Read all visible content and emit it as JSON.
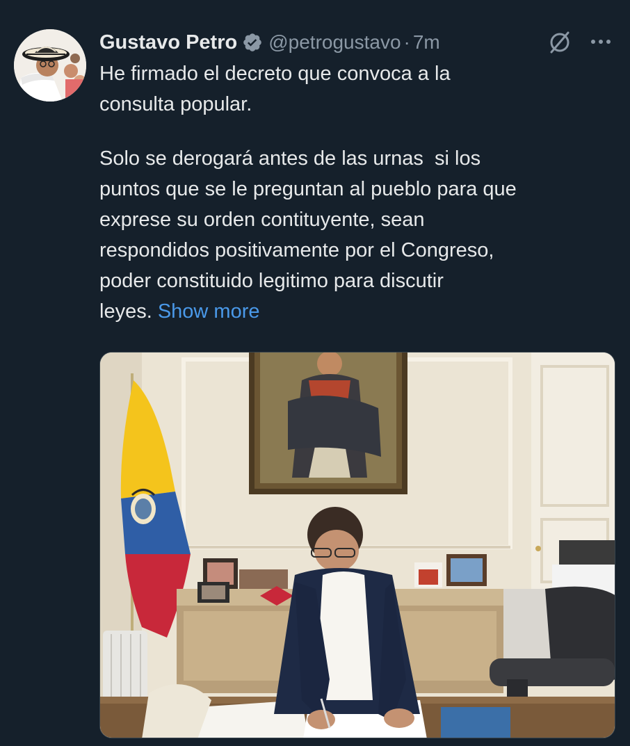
{
  "tweet": {
    "author": {
      "display_name": "Gustavo Petro",
      "verified_icon": "verified-badge-icon",
      "handle": "@petrogustavo",
      "separator": "·",
      "time_ago": "7m"
    },
    "actions": {
      "grok_icon": "grok-icon",
      "more_icon": "more-options-icon"
    },
    "text": {
      "line1": "He firmado el decreto que convoca a la",
      "line2": "consulta popular.",
      "line3": "Solo se derogará antes de las urnas  si los",
      "line4": "puntos que se le preguntan al pueblo para que",
      "line5": "exprese su orden contituyente, sean",
      "line6": "respondidos positivamente por el Congreso,",
      "line7": "poder constituido legitimo para discutir",
      "line8": "leyes. ",
      "show_more": "Show more"
    },
    "media": {
      "type": "photo"
    }
  },
  "colors": {
    "background": "#15202b",
    "text_primary": "#e7e9ea",
    "text_secondary": "#8b98a5",
    "link": "#4a99e9",
    "verified_badge": "#8b98a5"
  }
}
